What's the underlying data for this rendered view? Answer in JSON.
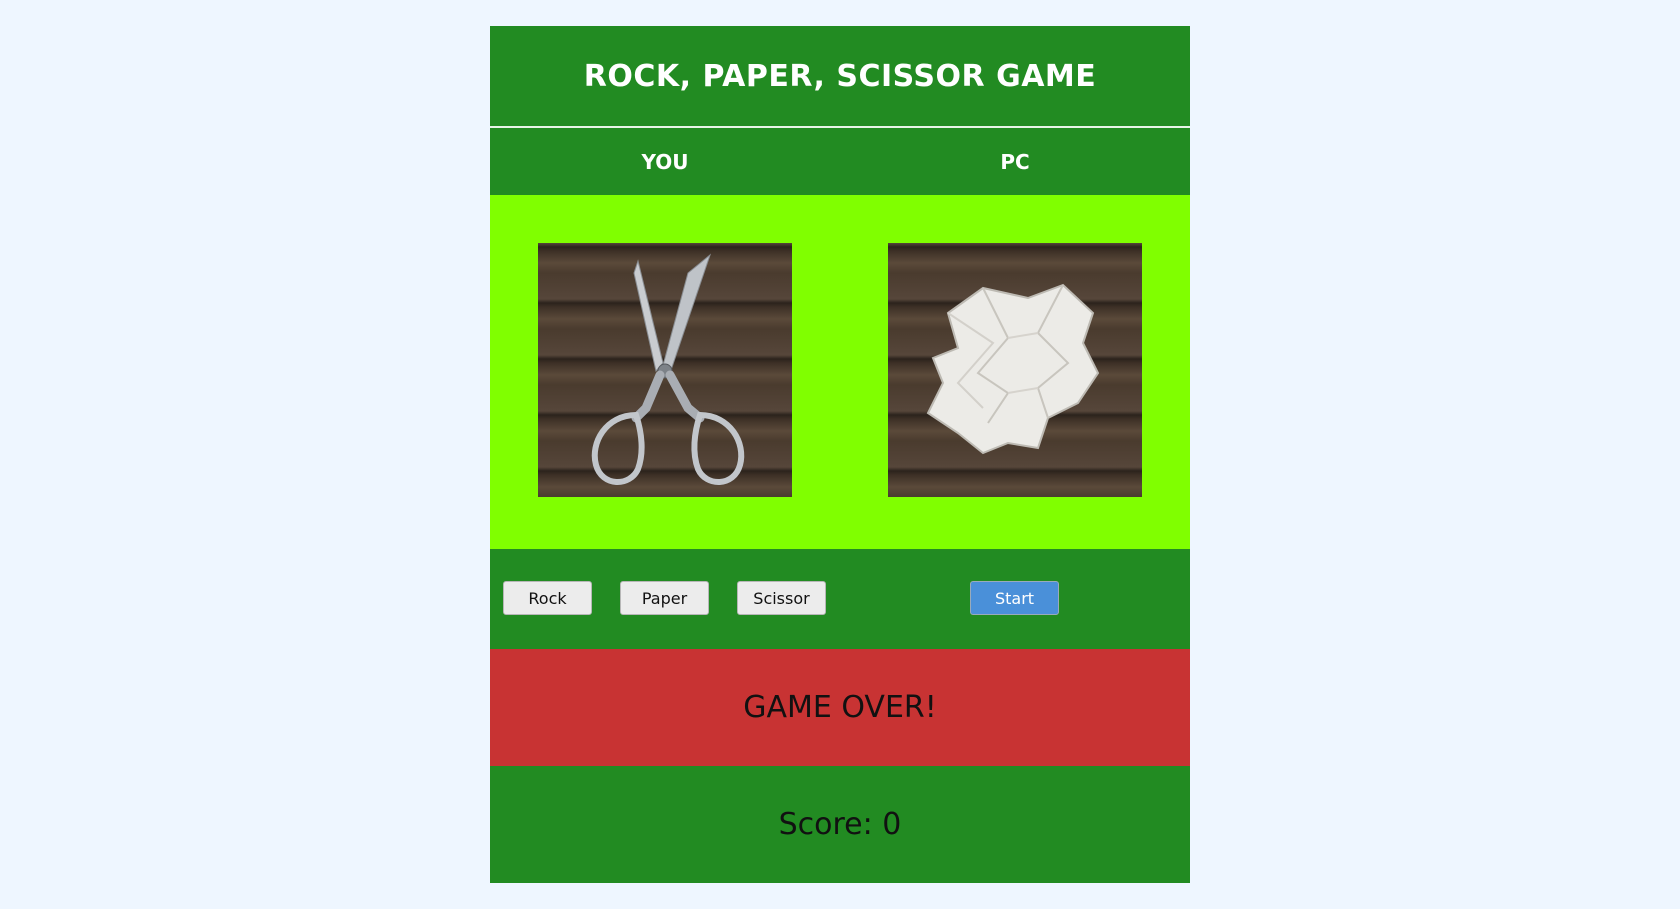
{
  "title": "ROCK, PAPER, SCISSOR GAME",
  "players": {
    "you_label": "YOU",
    "pc_label": "PC"
  },
  "arena": {
    "player_choice": "scissors-image",
    "pc_choice": "paper-image"
  },
  "controls": {
    "rock_label": "Rock",
    "paper_label": "Paper",
    "scissor_label": "Scissor",
    "start_label": "Start"
  },
  "status": {
    "message": "GAME OVER!"
  },
  "score": {
    "text": "Score: 0"
  },
  "colors": {
    "header_green": "#228b22",
    "arena_lime": "#80ff00",
    "status_red": "#c83333",
    "start_blue": "#4a90d9",
    "page_bg": "#eef6ff"
  }
}
